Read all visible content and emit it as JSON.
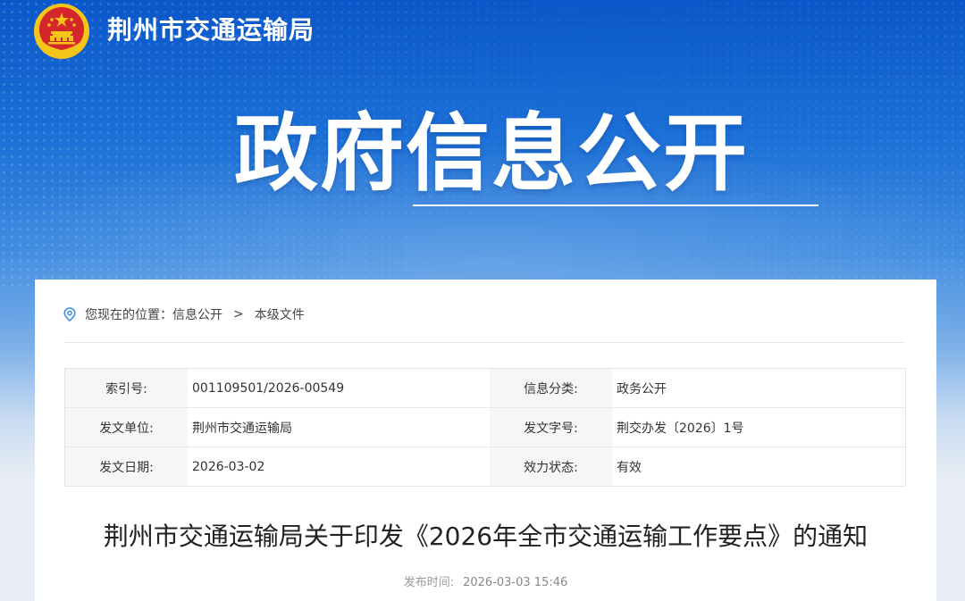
{
  "header": {
    "org_name": "荆州市交通运输局",
    "banner_title": "政府信息公开",
    "emblem_icon": "national-emblem-icon"
  },
  "breadcrumb": {
    "prefix": "您现在的位置：",
    "items": [
      "信息公开",
      "本级文件"
    ],
    "separator": ">"
  },
  "meta": {
    "rows": [
      {
        "label1": "索引号:",
        "value1": "001109501/2026-00549",
        "label2": "信息分类:",
        "value2": "政务公开"
      },
      {
        "label1": "发文单位:",
        "value1": "荆州市交通运输局",
        "label2": "发文字号:",
        "value2": "荆交办发〔2026〕1号"
      },
      {
        "label1": "发文日期:",
        "value1": "2026-03-02",
        "label2": "效力状态:",
        "value2": "有效"
      }
    ]
  },
  "document": {
    "title": "荆州市交通运输局关于印发《2026年全市交通运输工作要点》的通知",
    "publish_label": "发布时间:",
    "publish_time": "2026-03-03 15:46"
  },
  "colors": {
    "banner_blue": "#0a57c9",
    "emblem_red": "#d4262b",
    "emblem_gold": "#f5c518"
  }
}
